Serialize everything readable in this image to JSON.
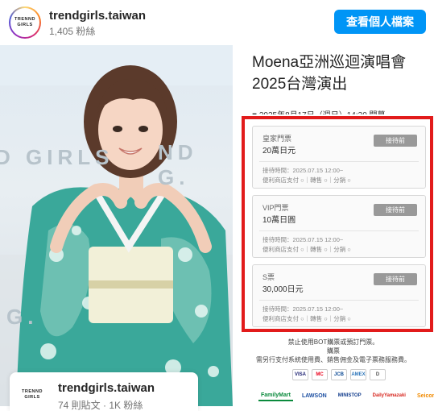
{
  "header": {
    "avatar_line1": "TRENND",
    "avatar_line2": "GIRLS",
    "username": "trendgirls.taiwan",
    "followers": "1,405 粉絲",
    "profile_button": "查看個人檔案"
  },
  "photo": {
    "banner_text_1": "D GIRLS",
    "banner_text_2": "ND G.",
    "banner_text_3": "G."
  },
  "poster": {
    "title_line1": "Moena亞洲巡迴演唱會",
    "title_line2": "2025台灣演出",
    "date_line": "■ 2025年8月17日（週日）14:30 開幕",
    "tickets": [
      {
        "name": "皇家門票",
        "price": "20萬日元",
        "status": "接待前",
        "time": "接待時間：2025.07.15 12:00~",
        "pay": "便利商店支付 ○｜轉售 ○｜分銷 ○"
      },
      {
        "name": "VIP門票",
        "price": "10萬日圓",
        "status": "接待前",
        "time": "接待時間：2025.07.15 12:00~",
        "pay": "便利商店支付 ○｜轉售 ○｜分銷 ○"
      },
      {
        "name": "S票",
        "price": "30,000日元",
        "status": "接待前",
        "time": "接待時間：2025.07.15 12:00~",
        "pay": "便利商店支付 ○｜轉售 ○｜分銷 ○"
      }
    ],
    "notice_1": "禁止使用BOT購票或預訂門票。",
    "notice_2": "購票",
    "notice_3": "需另行支付系統使用費、銷售佣金及電子票務服務費。",
    "payment_logos": [
      "VISA",
      "MC",
      "JCB",
      "AMEX",
      "D"
    ],
    "stores": [
      "FamilyMart",
      "LAWSON",
      "MINISTOP",
      "DailyYamazaki",
      "Seicomart"
    ]
  },
  "card": {
    "logo_line1": "TRENND",
    "logo_line2": "GIRLS",
    "name": "trendgirls.taiwan",
    "stats": "74 則貼文 · 1K 粉絲"
  },
  "colors": {
    "accent": "#0095f6",
    "highlight_box": "#e21b1b",
    "kimono": "#3aa89a"
  }
}
